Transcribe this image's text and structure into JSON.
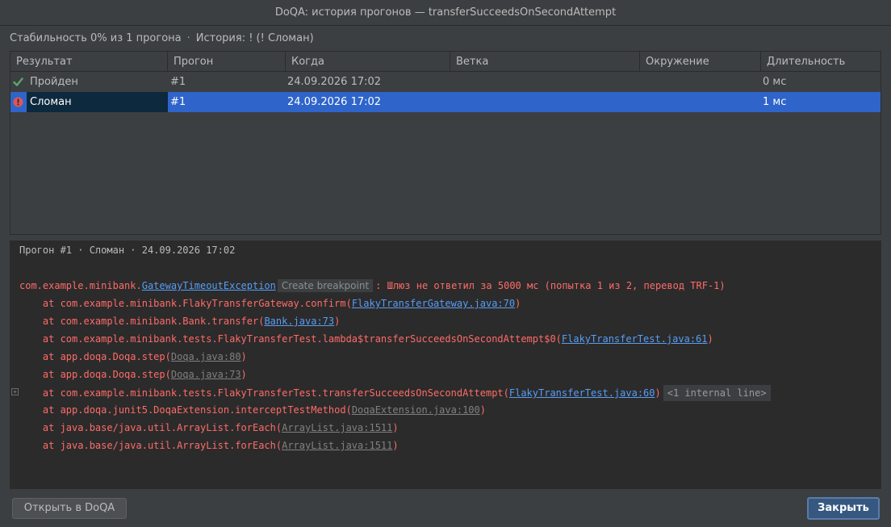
{
  "window": {
    "title": "DoQA: история прогонов — transferSucceedsOnSecondAttempt"
  },
  "summary": {
    "stability": "Стабильность 0% из 1 прогона",
    "separator": "·",
    "history": "История: ! (! Сломан)"
  },
  "table": {
    "columns": [
      "Результат",
      "Прогон",
      "Когда",
      "Ветка",
      "Окружение",
      "Длительность"
    ],
    "rows": [
      {
        "status": "passed",
        "result": "Пройден",
        "run": "#1",
        "when": "24.09.2026 17:02",
        "branch": "",
        "env": "",
        "duration": "0 мс"
      },
      {
        "status": "broken",
        "result": "Сломан",
        "run": "#1",
        "when": "24.09.2026 17:02",
        "branch": "",
        "env": "",
        "duration": "1 мс"
      }
    ]
  },
  "console": {
    "header": "Прогон #1 · Сломан · 24.09.2026 17:02",
    "exception": {
      "package": "com.example.minibank.",
      "class": "GatewayTimeoutException",
      "breakpoint_hint": "Create breakpoint",
      "message": ": Шлюз не ответил за 5000 мс (попытка 1 из 2, перевод TRF-1)"
    },
    "frames": [
      {
        "prefix": "    at com.example.minibank.FlakyTransferGateway.confirm(",
        "link": "FlakyTransferGateway.java:70",
        "suffix": ")"
      },
      {
        "prefix": "    at com.example.minibank.Bank.transfer(",
        "link": "Bank.java:73",
        "suffix": ")"
      },
      {
        "prefix": "    at com.example.minibank.tests.FlakyTransferTest.lambda$transferSucceedsOnSecondAttempt$0(",
        "link": "FlakyTransferTest.java:61",
        "suffix": ")"
      },
      {
        "prefix": "    at app.doqa.Doqa.step(",
        "link": "Doqa.java:80",
        "suffix": ")"
      },
      {
        "prefix": "    at app.doqa.Doqa.step(",
        "link": "Doqa.java:73",
        "suffix": ")"
      },
      {
        "prefix": "    at com.example.minibank.tests.FlakyTransferTest.transferSucceedsOnSecondAttempt(",
        "link": "FlakyTransferTest.java:60",
        "suffix": ")",
        "folded": "<1 internal line>"
      },
      {
        "prefix": "    at app.doqa.junit5.DoqaExtension.interceptTestMethod(",
        "link": "DoqaExtension.java:100",
        "suffix": ")"
      },
      {
        "prefix": "    at java.base/java.util.ArrayList.forEach(",
        "link": "ArrayList.java:1511",
        "suffix": ")"
      },
      {
        "prefix": "    at java.base/java.util.ArrayList.forEach(",
        "link": "ArrayList.java:1511",
        "suffix": ")"
      }
    ]
  },
  "buttons": {
    "open_label": "Открыть в DoQA",
    "close_label": "Закрыть"
  },
  "colors": {
    "passed": "#59a869",
    "broken": "#e05555",
    "selection": "#2f65ca",
    "error_text": "#ff6b68",
    "link": "#589df6"
  },
  "icons": {
    "passed": "check-icon",
    "broken": "error-icon",
    "fold": "expand-fold-icon"
  }
}
